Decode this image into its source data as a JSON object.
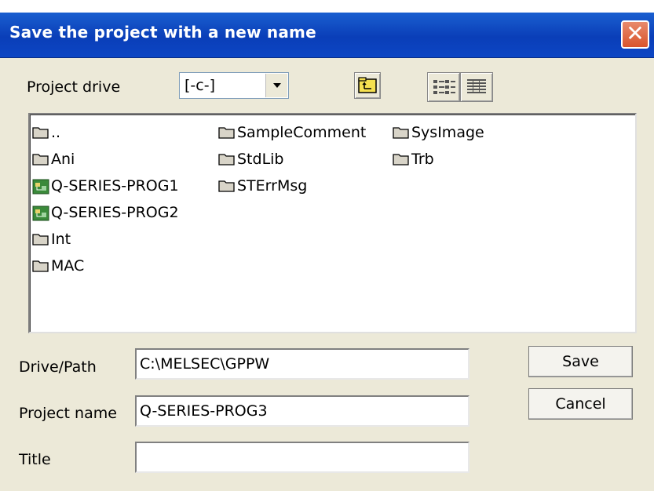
{
  "window": {
    "title": "Save the project with a new name",
    "close_glyph": "✕"
  },
  "drive": {
    "label": "Project drive",
    "selected": "[-c-]"
  },
  "toolbar": {
    "up_icon": "folder-up-icon",
    "list_view_icon": "list-view-icon",
    "detail_view_icon": "detail-view-icon"
  },
  "files": {
    "columns": [
      [
        {
          "name": "..",
          "icon": "folder-icon"
        },
        {
          "name": "Ani",
          "icon": "folder-icon"
        },
        {
          "name": "Q-SERIES-PROG1",
          "icon": "project-icon"
        },
        {
          "name": "Q-SERIES-PROG2",
          "icon": "project-icon"
        },
        {
          "name": "Int",
          "icon": "folder-icon"
        },
        {
          "name": "MAC",
          "icon": "folder-icon"
        }
      ],
      [
        {
          "name": "SampleComment",
          "icon": "folder-icon"
        },
        {
          "name": "StdLib",
          "icon": "folder-icon"
        },
        {
          "name": "STErrMsg",
          "icon": "folder-icon"
        }
      ],
      [
        {
          "name": "SysImage",
          "icon": "folder-icon"
        },
        {
          "name": "Trb",
          "icon": "folder-icon"
        }
      ]
    ]
  },
  "form": {
    "path_label": "Drive/Path",
    "path_value": "C:\\MELSEC\\GPPW",
    "name_label": "Project name",
    "name_value": "Q-SERIES-PROG3",
    "title_label": "Title",
    "title_value": ""
  },
  "buttons": {
    "save": "Save",
    "cancel": "Cancel"
  },
  "colors": {
    "titlebar": "#0a3eb8",
    "close": "#d9542c",
    "folder": "#d8d4c8",
    "project_icon": "#3a8a3a"
  }
}
